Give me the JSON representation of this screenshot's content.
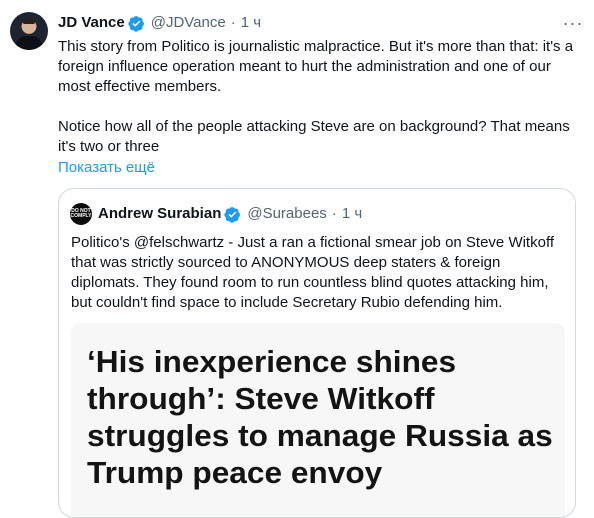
{
  "tweet": {
    "author_name": "JD Vance",
    "handle": "@JDVance",
    "separator": "·",
    "time": "1 ч",
    "more_icon": "more-horizontal-icon",
    "paragraphs": [
      "This story from Politico is journalistic malpractice. But it's more than that: it's a foreign influence operation meant to hurt the administration and one of our most effective members.",
      "Notice how all of the people attacking Steve are on background? That means it's two or three"
    ],
    "show_more": "Показать ещё",
    "accent_color": "#1d9bf0"
  },
  "quote": {
    "avatar_text": [
      "DO NOT",
      "COMPLY"
    ],
    "author_name": "Andrew Surabian",
    "handle": "@Surabees",
    "separator": "·",
    "time": "1 ч",
    "text": "Politico's @felschwartz - Just a ran a fictional smear job on Steve Witkoff that was strictly sourced to ANONYMOUS deep staters & foreign diplomats. They found room to run countless blind quotes attacking him, but couldn't find space to include Secretary Rubio defending him.",
    "headline": "‘His inexperience shines through’: Steve Witkoff struggles to manage Russia as Trump peace envoy"
  }
}
